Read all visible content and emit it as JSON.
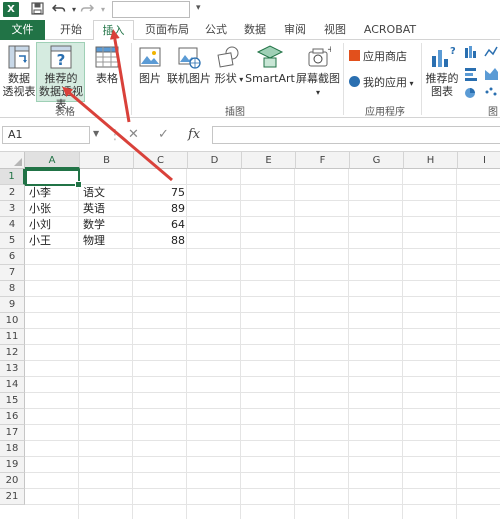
{
  "quick_access": {
    "logo": "X",
    "save_icon": "save-icon",
    "undo_icon": "undo-icon",
    "redo_icon": "redo-icon",
    "customize_caret": "▾"
  },
  "tabs": [
    {
      "label": "文件",
      "name": "tab-file"
    },
    {
      "label": "开始",
      "name": "tab-home"
    },
    {
      "label": "插入",
      "name": "tab-insert"
    },
    {
      "label": "页面布局",
      "name": "tab-page-layout"
    },
    {
      "label": "公式",
      "name": "tab-formulas"
    },
    {
      "label": "数据",
      "name": "tab-data"
    },
    {
      "label": "审阅",
      "name": "tab-review"
    },
    {
      "label": "视图",
      "name": "tab-view"
    },
    {
      "label": "ACROBAT",
      "name": "tab-acrobat"
    }
  ],
  "ribbon": {
    "tables": {
      "pivot_line1": "数据",
      "pivot_line2": "透视表",
      "recommended_line1": "推荐的",
      "recommended_line2": "数据透视表",
      "table_label": "表格",
      "group_label": "表格"
    },
    "illustrations": {
      "pictures": "图片",
      "online_pictures": "联机图片",
      "shapes": "形状",
      "smartart": "SmartArt",
      "screenshot": "屏幕截图",
      "group_label": "插图"
    },
    "apps": {
      "store": "应用商店",
      "my_apps": "我的应用",
      "group_label": "应用程序"
    },
    "charts": {
      "recommended_line1": "推荐的",
      "recommended_line2": "图表",
      "group_label_partial": "图"
    }
  },
  "formula_bar": {
    "namebox_value": "A1",
    "cancel_icon": "✕",
    "enter_icon": "✓",
    "fx_label": "fx"
  },
  "grid": {
    "columns": [
      "A",
      "B",
      "C",
      "D",
      "E",
      "F",
      "G",
      "H",
      "I"
    ],
    "rows": [
      "1",
      "2",
      "3",
      "4",
      "5",
      "6",
      "7",
      "8",
      "9",
      "10",
      "11",
      "12",
      "13",
      "14",
      "15",
      "16",
      "17",
      "18",
      "19",
      "20",
      "21"
    ],
    "data": [
      [
        "",
        "",
        ""
      ],
      [
        "小李",
        "语文",
        "75"
      ],
      [
        "小张",
        "英语",
        "89"
      ],
      [
        "小刘",
        "数学",
        "64"
      ],
      [
        "小王",
        "物理",
        "88"
      ]
    ]
  },
  "colors": {
    "accent": "#217346",
    "arrow": "#d9413a"
  }
}
